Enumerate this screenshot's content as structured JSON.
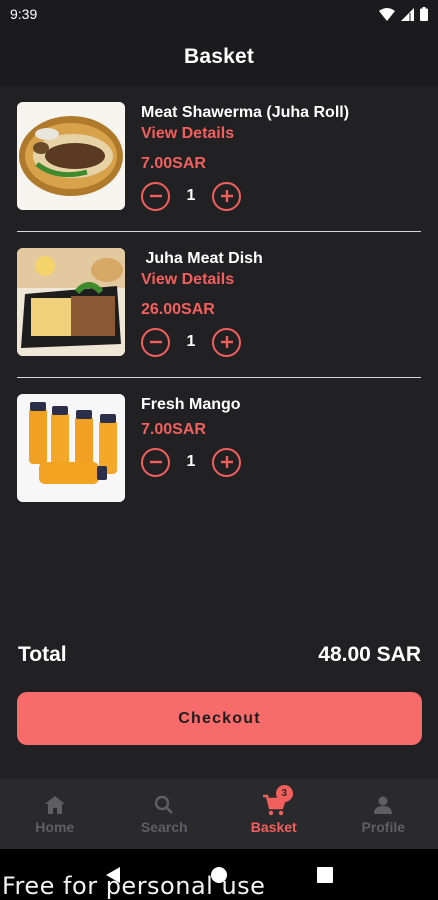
{
  "status_bar": {
    "time": "9:39"
  },
  "header": {
    "title": "Basket"
  },
  "items": [
    {
      "name": "Meat Shawerma (Juha Roll)",
      "details_label": "View Details",
      "price": "7.00SAR",
      "quantity": "1",
      "image": "shawerma-roll-image"
    },
    {
      "name": " Juha Meat Dish",
      "details_label": "View Details",
      "price": "26.00SAR",
      "quantity": "1",
      "image": "meat-dish-image"
    },
    {
      "name": "Fresh Mango",
      "details_label": "",
      "price": "7.00SAR",
      "quantity": "1",
      "image": "mango-juice-image"
    }
  ],
  "summary": {
    "total_label": "Total",
    "total_value": "48.00 SAR"
  },
  "checkout": {
    "label": "Checkout"
  },
  "nav": {
    "items": [
      {
        "label": "Home",
        "icon": "home-icon",
        "active": false
      },
      {
        "label": "Search",
        "icon": "search-icon",
        "active": false
      },
      {
        "label": "Basket",
        "icon": "cart-icon",
        "active": true,
        "badge": "3"
      },
      {
        "label": "Profile",
        "icon": "profile-icon",
        "active": false
      }
    ]
  },
  "watermark": "Free for personal use",
  "colors": {
    "accent": "#f25f5c",
    "checkout_bg": "#f76b6b",
    "background": "#212124",
    "bar": "#1b1b1d",
    "nav_bg": "#2a2a2d",
    "inactive": "#5f5f63"
  }
}
